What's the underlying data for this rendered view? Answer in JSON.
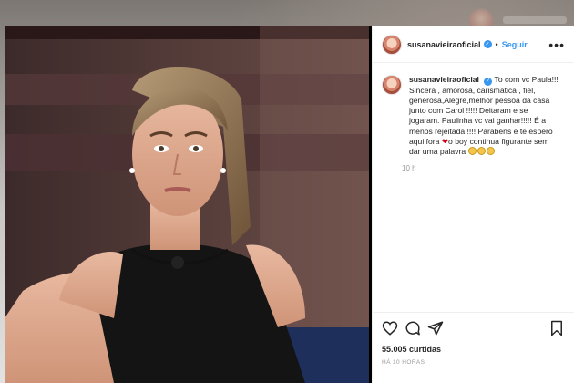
{
  "post": {
    "username": "susanavieiraoficial",
    "follow_label": "Seguir",
    "separator": "•",
    "more_label": "•••",
    "caption_parts": {
      "p1": "To com vc Paula!!! Sincera , amorosa, carismática , fiel, generosa,Alegre,melhor pessoa da casa junto com Carol !!!!! Deitaram e se jogaram. Paulinha vc vai ganhar!!!!! É a menos rejeitada !!!! Parabéns e te espero aqui fora ",
      "heart": "❤",
      "p2": "o boy continua figurante sem dar uma palavra "
    },
    "caption_age": "10 h",
    "likes": "55.005 curtidas",
    "timestamp": "HÁ 10 HORAS",
    "icons": [
      "heart-icon",
      "comment-icon",
      "share-icon",
      "bookmark-icon"
    ],
    "accent_color": "#3897f0"
  }
}
